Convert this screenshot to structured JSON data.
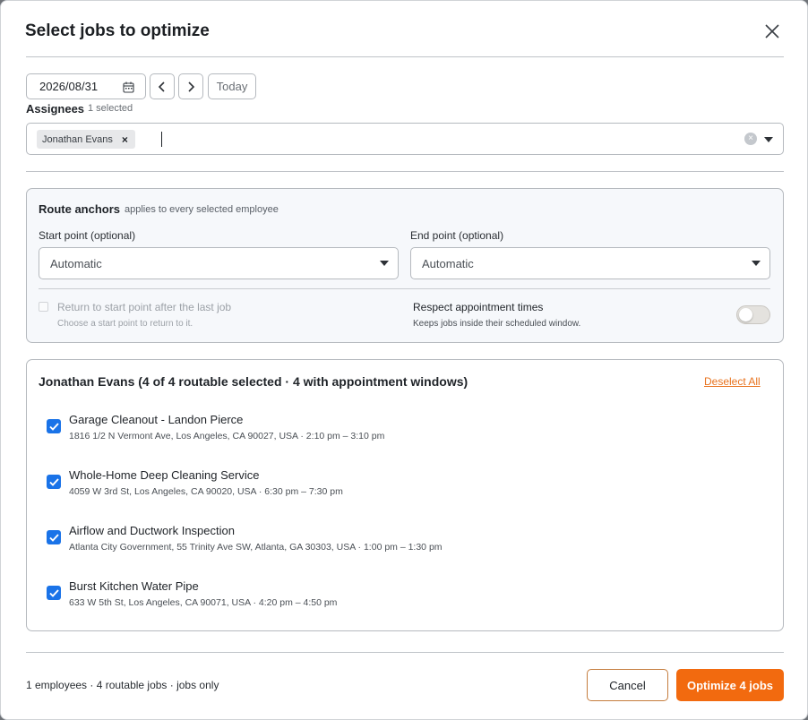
{
  "dialog": {
    "title": "Select jobs to optimize",
    "close_label": "close"
  },
  "date_bar": {
    "date_value": "2026/08/31",
    "today_label": "Today"
  },
  "assignees": {
    "label": "Assignees",
    "count_text": "1 selected",
    "chips": [
      {
        "label": "Jonathan Evans"
      }
    ]
  },
  "anchors": {
    "title": "Route anchors",
    "subtitle": "applies to every selected employee",
    "start_label": "Start point (optional)",
    "start_value": "Automatic",
    "end_label": "End point (optional)",
    "end_value": "Automatic",
    "return_label": "Return to start point after the last job",
    "return_hint": "Choose a start point to return to it.",
    "return_checked": false,
    "respect_label": "Respect appointment times",
    "respect_hint": "Keeps jobs inside their scheduled window.",
    "respect_on": false
  },
  "jobs_panel": {
    "title": "Jonathan Evans (4 of 4 routable selected · 4 with appointment windows)",
    "deselect_label": "Deselect All",
    "items": [
      {
        "name": "Garage Cleanout - Landon Pierce",
        "address": "1816 1/2 N Vermont Ave, Los Angeles, CA 90027, USA · 2:10 pm – 3:10 pm",
        "checked": true
      },
      {
        "name": "Whole-Home Deep Cleaning Service",
        "address": "4059 W 3rd St, Los Angeles, CA 90020, USA · 6:30 pm – 7:30 pm",
        "checked": true
      },
      {
        "name": "Airflow and Ductwork Inspection",
        "address": "Atlanta City Government, 55 Trinity Ave SW, Atlanta, GA 30303, USA · 1:00 pm – 1:30 pm",
        "checked": true
      },
      {
        "name": "Burst Kitchen Water Pipe",
        "address": "633 W 5th St, Los Angeles, CA 90071, USA · 4:20 pm – 4:50 pm",
        "checked": true
      }
    ]
  },
  "footer": {
    "summary": "1 employees · 4 routable jobs · jobs only",
    "cancel_label": "Cancel",
    "submit_label": "Optimize 4 jobs"
  },
  "colors": {
    "accent_orange": "#f26a0f",
    "checkbox_blue": "#1a73e8",
    "link_orange": "#e8731f"
  }
}
